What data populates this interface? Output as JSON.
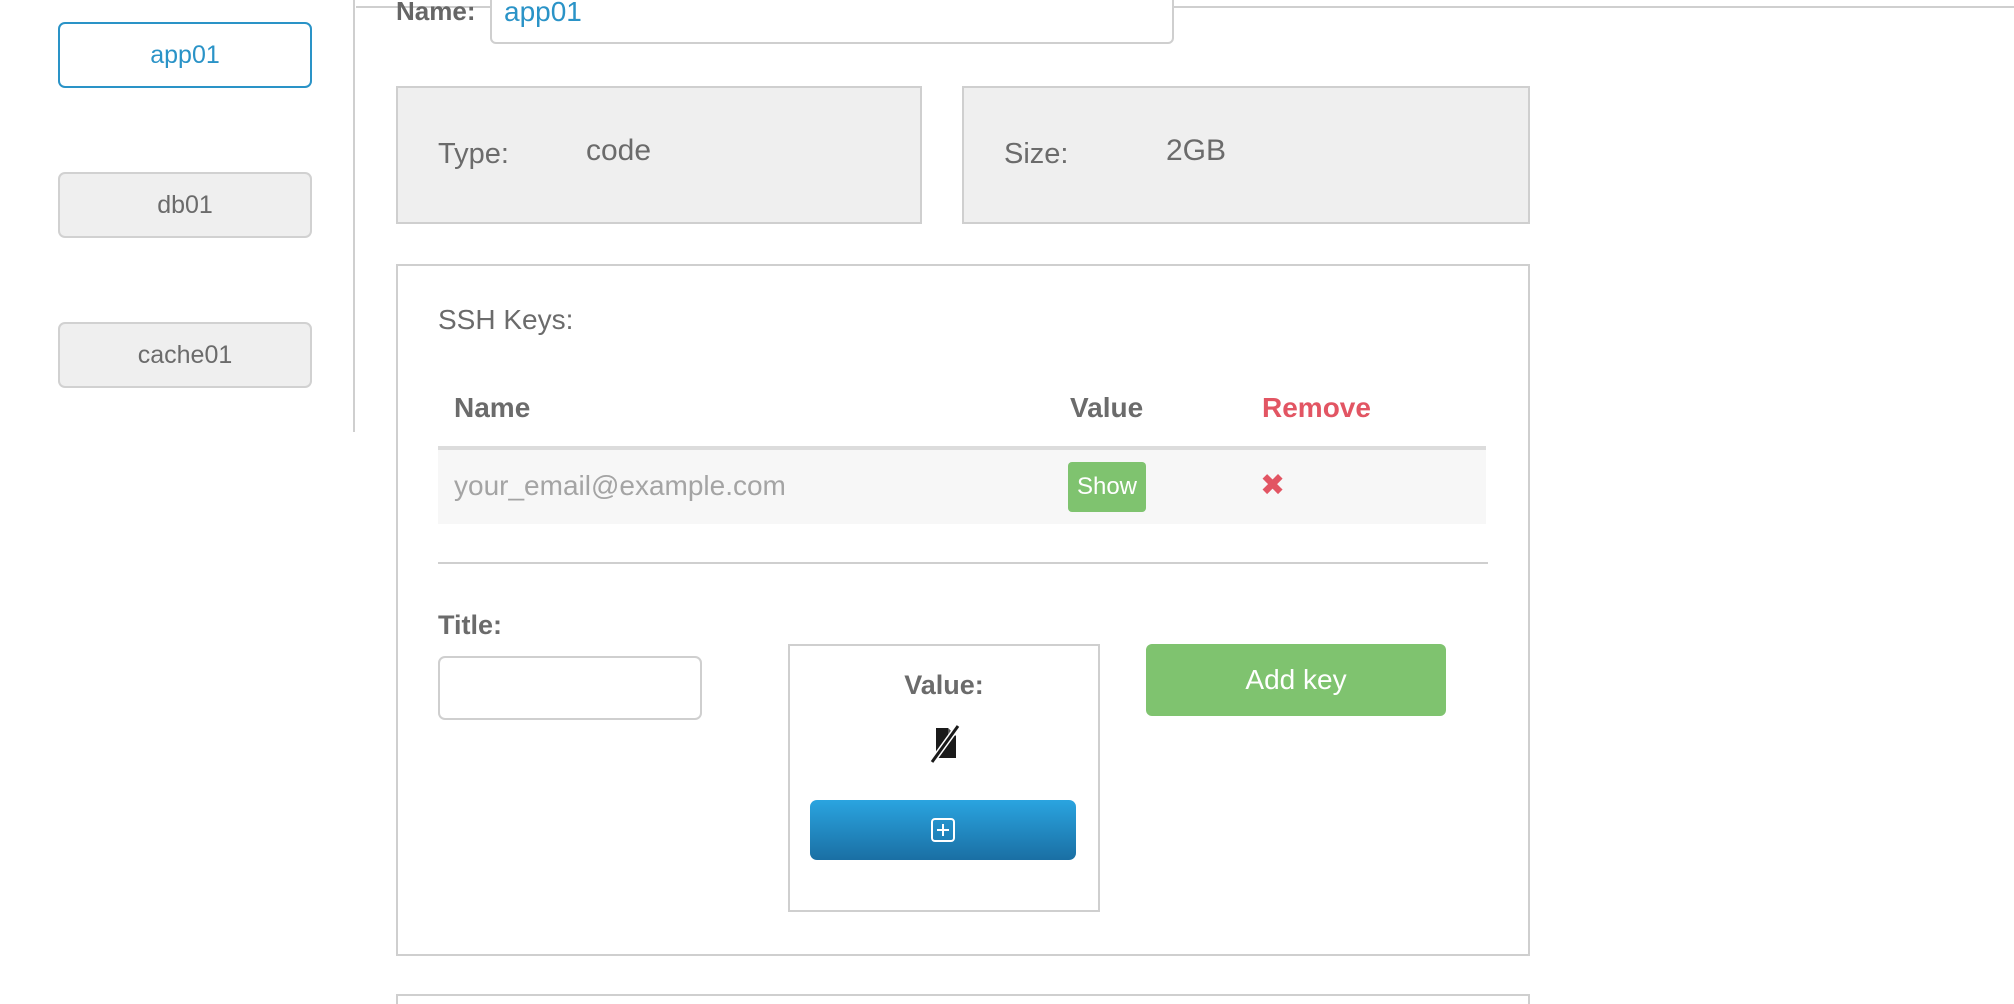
{
  "sidebar": {
    "items": [
      {
        "label": "app01",
        "active": true
      },
      {
        "label": "db01",
        "active": false
      },
      {
        "label": "cache01",
        "active": false
      }
    ]
  },
  "name_field": {
    "label": "Name:",
    "value": "app01"
  },
  "info": {
    "type_label": "Type:",
    "type_value": "code",
    "size_label": "Size:",
    "size_value": "2GB"
  },
  "ssh": {
    "title": "SSH Keys:",
    "columns": [
      "Name",
      "Value",
      "Remove"
    ],
    "rows": [
      {
        "name": "your_email@example.com",
        "value_action": "Show",
        "remove_icon": "close-icon"
      }
    ],
    "form": {
      "title_label": "Title:",
      "title_value": "",
      "value_label": "Value:",
      "value_icon": "no-file-icon",
      "upload_icon": "plus-square-icon",
      "add_button": "Add key"
    }
  },
  "colors": {
    "accent": "#2a93c7",
    "success": "#7fc36f",
    "danger": "#e25563",
    "upload_blue": "#1f88c4"
  }
}
